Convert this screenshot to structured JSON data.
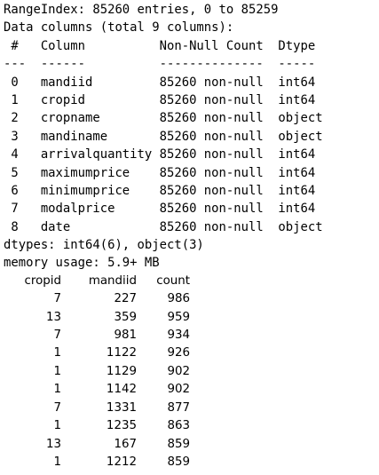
{
  "info": {
    "range_index": "RangeIndex: 85260 entries, 0 to 85259",
    "data_columns": "Data columns (total 9 columns):",
    "header": " #   Column          Non-Null Count  Dtype ",
    "separator": "---  ------          --------------  ----- ",
    "rows": [
      " 0   mandiid         85260 non-null  int64 ",
      " 1   cropid          85260 non-null  int64 ",
      " 2   cropname        85260 non-null  object",
      " 3   mandiname       85260 non-null  object",
      " 4   arrivalquantity 85260 non-null  int64 ",
      " 5   maximumprice    85260 non-null  int64 ",
      " 6   minimumprice    85260 non-null  int64 ",
      " 7   modalprice      85260 non-null  int64 ",
      " 8   date            85260 non-null  object"
    ],
    "dtypes": "dtypes: int64(6), object(3)",
    "memory": "memory usage: 5.9+ MB"
  },
  "count_table": {
    "columns": [
      "cropid",
      "mandiid",
      "count"
    ],
    "rows": [
      [
        "7",
        "227",
        "986"
      ],
      [
        "13",
        "359",
        "959"
      ],
      [
        "7",
        "981",
        "934"
      ],
      [
        "1",
        "1122",
        "926"
      ],
      [
        "1",
        "1129",
        "902"
      ],
      [
        "1",
        "1142",
        "902"
      ],
      [
        "7",
        "1331",
        "877"
      ],
      [
        "1",
        "1235",
        "863"
      ],
      [
        "13",
        "167",
        "859"
      ],
      [
        "1",
        "1212",
        "859"
      ]
    ]
  }
}
